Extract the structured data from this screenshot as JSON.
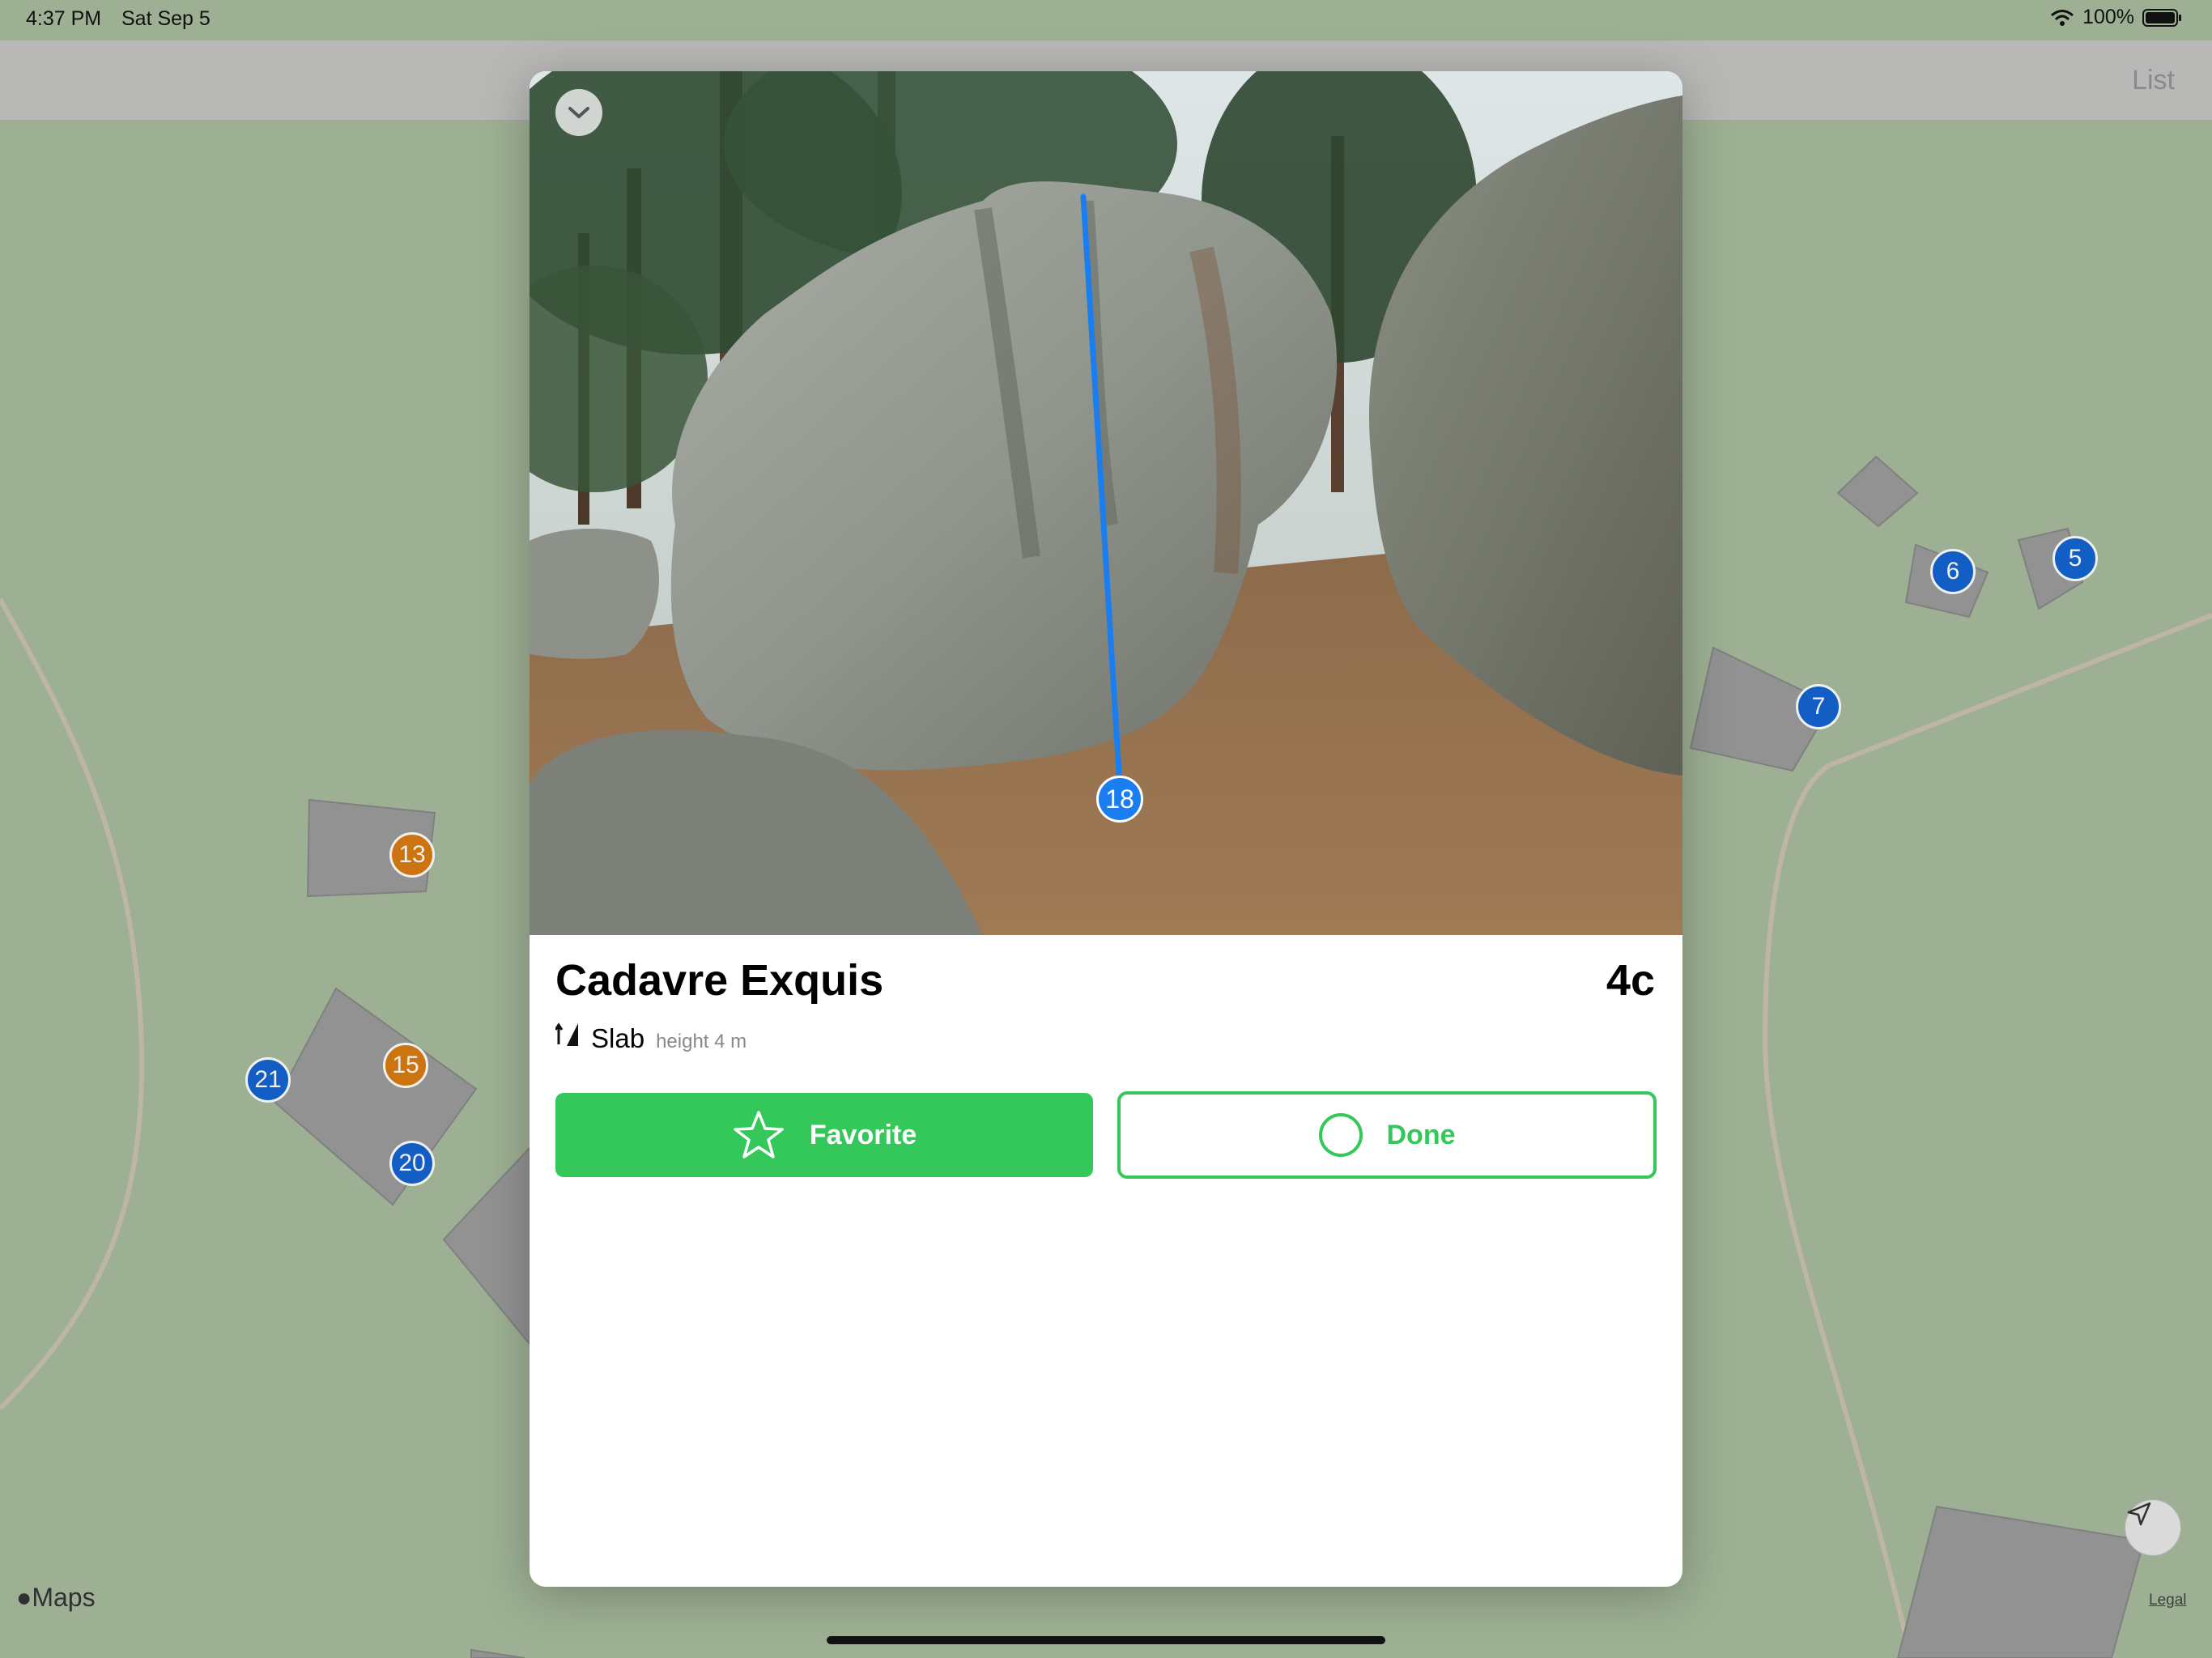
{
  "status_bar": {
    "time": "4:37 PM",
    "date": "Sat Sep 5",
    "battery": "100%",
    "icons": [
      "wifi-icon",
      "battery-icon"
    ]
  },
  "nav": {
    "list_label": "List"
  },
  "map": {
    "markers": [
      {
        "number": "5",
        "color": "blue"
      },
      {
        "number": "6",
        "color": "blue"
      },
      {
        "number": "7",
        "color": "blue"
      },
      {
        "number": "13",
        "color": "orange"
      },
      {
        "number": "15",
        "color": "orange"
      },
      {
        "number": "20",
        "color": "blue"
      },
      {
        "number": "21",
        "color": "blue"
      }
    ],
    "attribution": "Maps",
    "legal": "Legal"
  },
  "problem": {
    "route_number": "18",
    "name": "Cadavre Exquis",
    "grade": "4c",
    "style": "Slab",
    "height": "height 4 m",
    "favorite_label": "Favorite",
    "done_label": "Done"
  },
  "colors": {
    "accent_green": "#34c85a",
    "marker_blue": "#1464d2",
    "marker_orange": "#d97c12",
    "route_line": "#1a7ef0"
  }
}
